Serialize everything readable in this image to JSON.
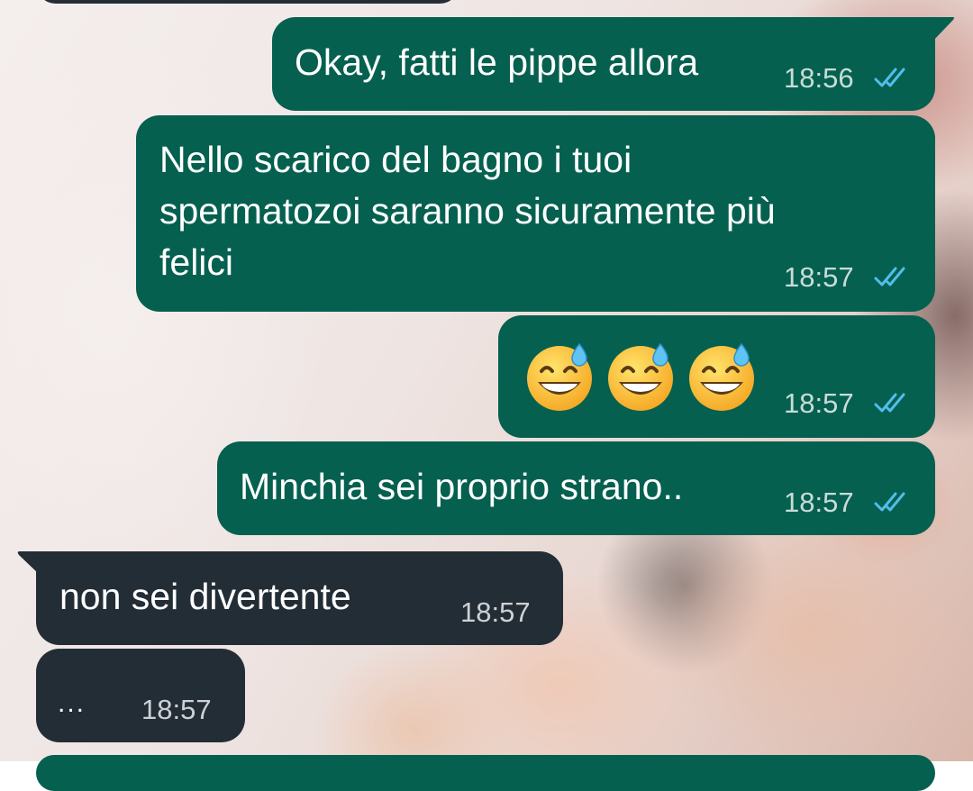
{
  "colors": {
    "outgoing_bubble": "#05604f",
    "incoming_bubble": "#232d36",
    "read_ticks": "#53bdeb"
  },
  "messages": [
    {
      "direction": "outgoing",
      "lines": [
        "Okay, fatti le pippe allora"
      ],
      "time": "18:56",
      "status": "read"
    },
    {
      "direction": "outgoing",
      "lines": [
        "Nello scarico del bagno i tuoi",
        "spermatozoi saranno sicuramente più",
        "felici"
      ],
      "time": "18:57",
      "status": "read"
    },
    {
      "direction": "outgoing",
      "emoji": [
        "grinning-face-with-sweat",
        "grinning-face-with-sweat",
        "grinning-face-with-sweat"
      ],
      "time": "18:57",
      "status": "read"
    },
    {
      "direction": "outgoing",
      "lines": [
        "Minchia sei proprio strano.."
      ],
      "time": "18:57",
      "status": "read"
    },
    {
      "direction": "incoming",
      "lines": [
        "non sei divertente"
      ],
      "time": "18:57"
    },
    {
      "direction": "incoming",
      "lines": [
        "..."
      ],
      "time": "18:57"
    }
  ]
}
